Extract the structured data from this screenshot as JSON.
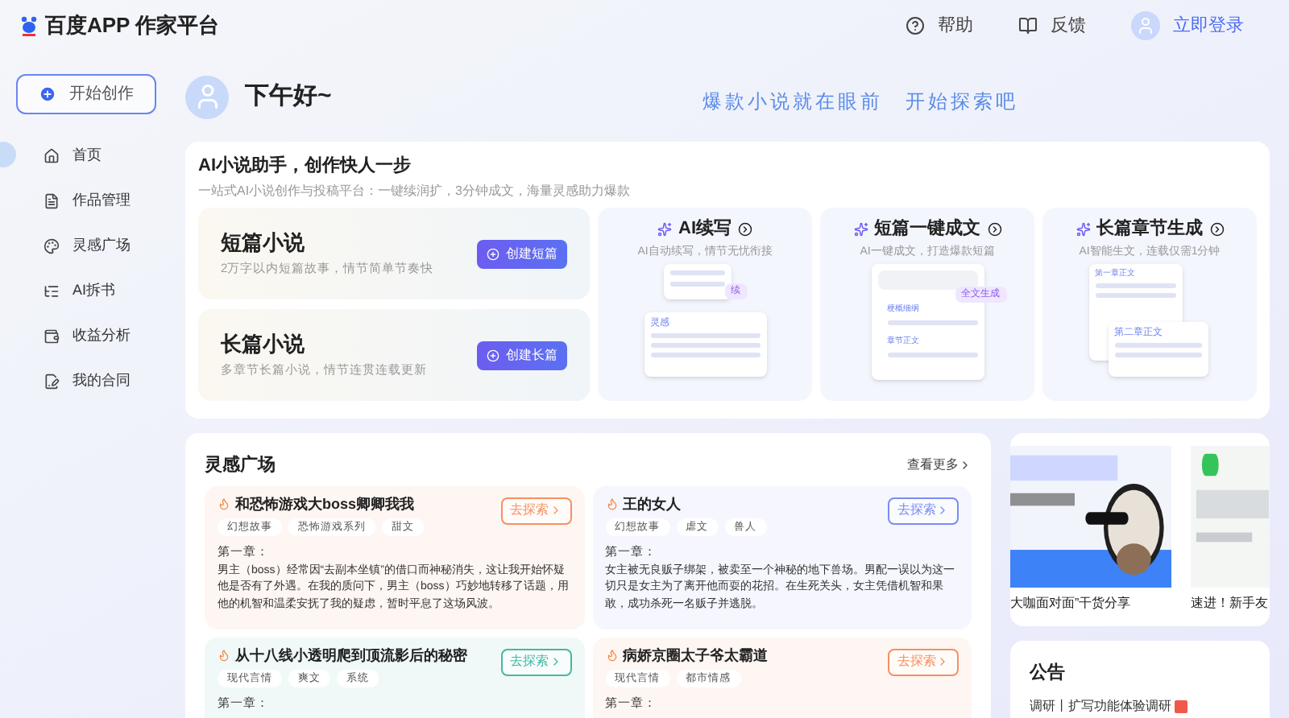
{
  "header": {
    "logo": "百度APP 作家平台",
    "links": [
      {
        "kind": "help",
        "label": "帮助"
      },
      {
        "kind": "feedback",
        "label": "反馈"
      }
    ],
    "login": "立即登录"
  },
  "sidebar": {
    "create_button": "开始创作",
    "items": [
      {
        "kind": "home",
        "label": "首页"
      },
      {
        "kind": "works",
        "label": "作品管理"
      },
      {
        "kind": "idea",
        "label": "灵感广场"
      },
      {
        "kind": "split",
        "label": "AI拆书"
      },
      {
        "kind": "income",
        "label": "收益分析"
      },
      {
        "kind": "contract",
        "label": "我的合同"
      }
    ]
  },
  "greeting": "下午好~",
  "slogan": "爆款小说就在眼前　开始探索吧",
  "assistant": {
    "title": "AI小说助手，创作快人一步",
    "subtitle": "一站式AI小说创作与投稿平台：一键续润扩，3分钟成文，海量灵感助力爆款",
    "novels": [
      {
        "title": "短篇小说",
        "desc": "2万字以内短篇故事，情节简单节奏快",
        "button": "创建短篇"
      },
      {
        "title": "长篇小说",
        "desc": "多章节长篇小说，情节连贯连载更新",
        "button": "创建长篇"
      }
    ],
    "tools": [
      {
        "kind": "continue",
        "title": "AI续写",
        "desc": "AI自动续写，情节无忧衔接",
        "labels": [
          "续",
          "灵感"
        ]
      },
      {
        "kind": "oneclick",
        "title": "短篇一键成文",
        "desc": "AI一键成文，打造爆款短篇",
        "labels": [
          "全文生成",
          "梗概细纲",
          "章节正文"
        ]
      },
      {
        "kind": "chapters",
        "title": "长篇章节生成",
        "desc": "AI智能生文，连载仅需1分钟",
        "labels": [
          "第一章正文",
          "第二章正文"
        ]
      }
    ]
  },
  "inspiration": {
    "title": "灵感广场",
    "more": "查看更多",
    "cards": [
      {
        "title": "和恐怖游戏大boss卿卿我我",
        "color": "#f7905f",
        "tags": [
          "幻想故事",
          "恐怖游戏系列",
          "甜文"
        ],
        "button": "去探索",
        "chapter": "第一章：",
        "text": "男主（boss）经常因“去副本坐镇”的借口而神秘消失，这让我开始怀疑他是否有了外遇。在我的质问下，男主（boss）巧妙地转移了话题，用他的机智和温柔安抚了我的疑虑，暂时平息了这场风波。"
      },
      {
        "title": "王的女人",
        "color": "#7b8cf2",
        "tags": [
          "幻想故事",
          "虐文",
          "兽人"
        ],
        "button": "去探索",
        "chapter": "第一章：",
        "text": "女主被无良贩子绑架，被卖至一个神秘的地下兽场。男配一误以为这一切只是女主为了离开他而耍的花招。在生死关头，女主凭借机智和果敢，成功杀死一名贩子并逃脱。"
      },
      {
        "title": "从十八线小透明爬到顶流影后的秘密",
        "color": "#45b8a2",
        "tags": [
          "现代言情",
          "爽文",
          "系统"
        ],
        "button": "去探索",
        "chapter": "第一章："
      },
      {
        "title": "病娇京圈太子爷太霸道",
        "color": "#f7905f",
        "tags": [
          "现代言情",
          "都市情感"
        ],
        "button": "去探索",
        "chapter": "第一章："
      }
    ]
  },
  "banners": [
    {
      "caption": "大咖面对面”干货分享"
    },
    {
      "caption": "速进！新手友"
    }
  ],
  "notice": {
    "title": "公告",
    "items": [
      {
        "text": "调研丨扩写功能体验调研",
        "new": true
      }
    ]
  }
}
